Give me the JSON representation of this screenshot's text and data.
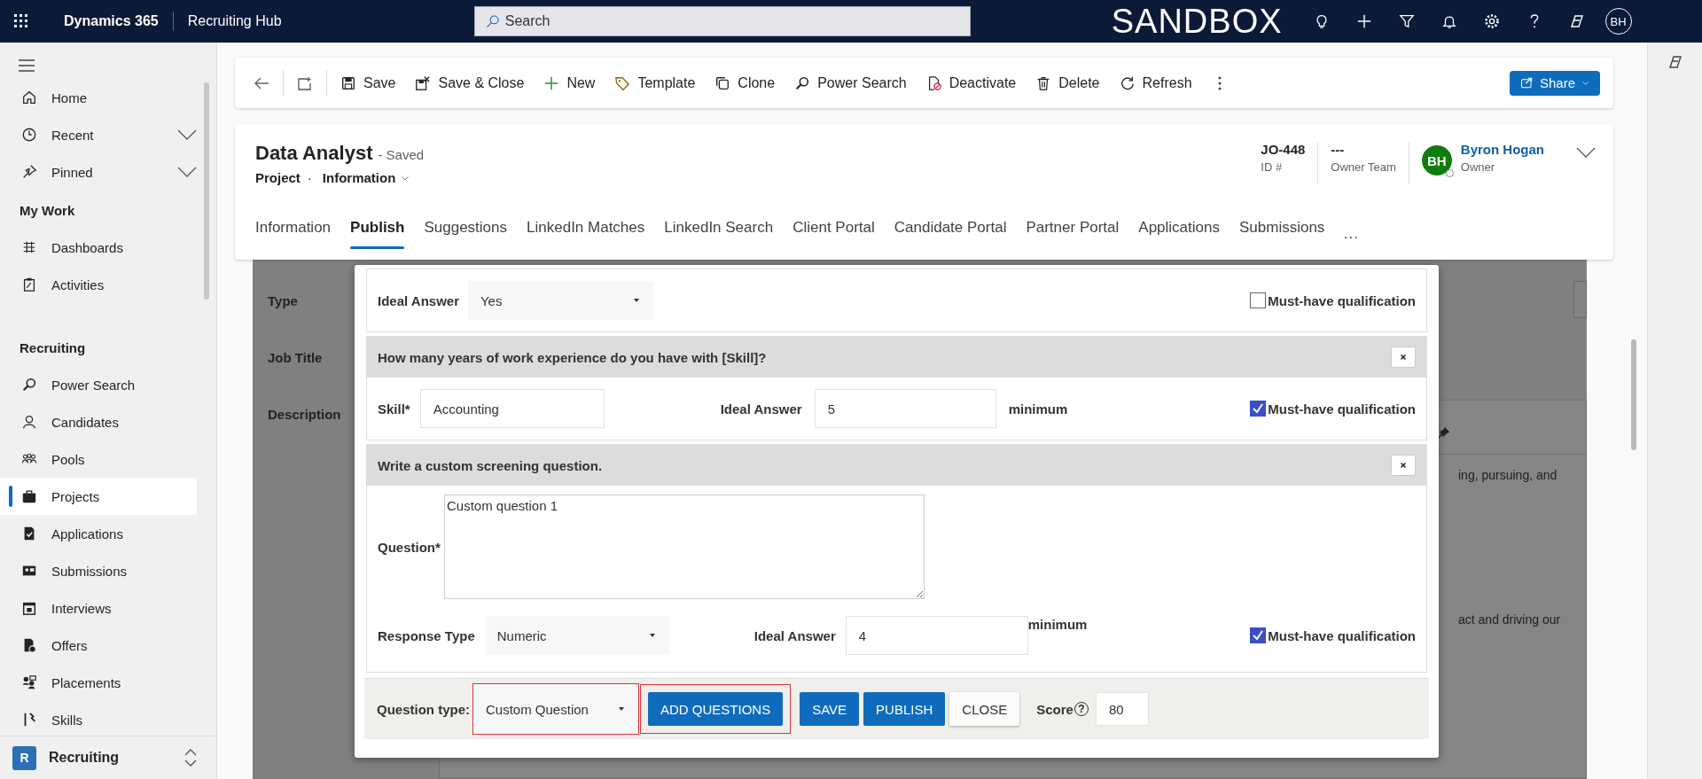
{
  "top_bar": {
    "app_name": "Dynamics 365",
    "area": "Recruiting Hub",
    "search_placeholder": "Search",
    "environment": "SANDBOX",
    "avatar": "BH"
  },
  "sidebar": {
    "sections": [
      {
        "items": [
          {
            "label": "Home",
            "selected": false
          },
          {
            "label": "Recent",
            "selected": false,
            "expandable": true
          },
          {
            "label": "Pinned",
            "selected": false,
            "expandable": true
          }
        ]
      },
      {
        "title": "My Work",
        "items": [
          {
            "label": "Dashboards",
            "selected": false
          },
          {
            "label": "Activities",
            "selected": false
          }
        ]
      },
      {
        "title": "Recruiting",
        "items": [
          {
            "label": "Power Search",
            "selected": false
          },
          {
            "label": "Candidates",
            "selected": false
          },
          {
            "label": "Pools",
            "selected": false
          },
          {
            "label": "Projects",
            "selected": true
          },
          {
            "label": "Applications",
            "selected": false
          },
          {
            "label": "Submissions",
            "selected": false
          },
          {
            "label": "Interviews",
            "selected": false
          },
          {
            "label": "Offers",
            "selected": false
          },
          {
            "label": "Placements",
            "selected": false
          },
          {
            "label": "Skills",
            "selected": false
          }
        ]
      }
    ],
    "area_switcher": {
      "badge": "R",
      "label": "Recruiting"
    }
  },
  "command_bar": {
    "commands": [
      "Save",
      "Save & Close",
      "New",
      "Template",
      "Clone",
      "Power Search",
      "Deactivate",
      "Delete",
      "Refresh"
    ],
    "share": "Share"
  },
  "record": {
    "title": "Data Analyst",
    "status": "- Saved",
    "entity": "Project",
    "separator": "·",
    "form": "Information",
    "fields": [
      {
        "value": "JO-448",
        "label": "ID #"
      },
      {
        "value": "---",
        "label": "Owner Team"
      }
    ],
    "owner": {
      "initials": "BH",
      "name": "Byron Hogan",
      "label": "Owner"
    }
  },
  "tabs": [
    {
      "label": "Information",
      "selected": false
    },
    {
      "label": "Publish",
      "selected": true
    },
    {
      "label": "Suggestions",
      "selected": false
    },
    {
      "label": "LinkedIn Matches",
      "selected": false
    },
    {
      "label": "LinkedIn Search",
      "selected": false
    },
    {
      "label": "Client Portal",
      "selected": false
    },
    {
      "label": "Candidate Portal",
      "selected": false
    },
    {
      "label": "Partner Portal",
      "selected": false
    },
    {
      "label": "Applications",
      "selected": false
    },
    {
      "label": "Submissions",
      "selected": false
    }
  ],
  "tabs_more": "···",
  "background_form": {
    "labels": [
      "Type",
      "Job Title",
      "Description"
    ],
    "text_fragments": [
      "ing, pursuing, and",
      "act and driving our"
    ]
  },
  "dialog": {
    "questions": [
      {
        "kind": "choice",
        "ideal_label": "Ideal Answer",
        "ideal_value": "Yes",
        "must_have_label": "Must-have qualification",
        "must_have": false
      },
      {
        "kind": "skill",
        "header": "How many years of work experience do you have with [Skill]?",
        "skill_label": "Skill*",
        "skill_value": "Accounting",
        "ideal_label": "Ideal Answer",
        "ideal_value": "5",
        "unit": "minimum",
        "must_have_label": "Must-have qualification",
        "must_have": true
      },
      {
        "kind": "custom",
        "header": "Write a custom screening question.",
        "question_label": "Question*",
        "question_value": "Custom question 1",
        "response_label": "Response Type",
        "response_value": "Numeric",
        "ideal_label": "Ideal Answer",
        "ideal_value": "4",
        "unit": "minimum",
        "must_have_label": "Must-have qualification",
        "must_have": true
      }
    ],
    "footer": {
      "question_type_label": "Question type:",
      "question_type_value": "Custom Question",
      "question_type_highlighted": true,
      "buttons": [
        {
          "label": "ADD QUESTIONS",
          "kind": "primary",
          "highlighted": true
        },
        {
          "label": "SAVE",
          "kind": "primary",
          "highlighted": false
        },
        {
          "label": "PUBLISH",
          "kind": "primary",
          "highlighted": false
        },
        {
          "label": "CLOSE",
          "kind": "secondary",
          "highlighted": false
        }
      ],
      "score_label": "Score",
      "score_help": "?",
      "score_value": "80"
    }
  }
}
